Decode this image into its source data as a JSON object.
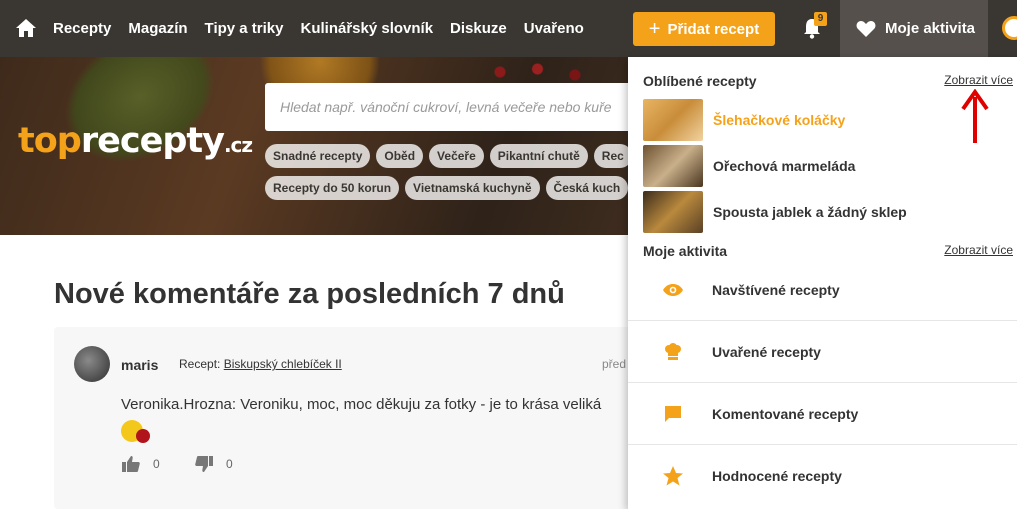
{
  "nav": {
    "links": [
      "Recepty",
      "Magazín",
      "Tipy a triky",
      "Kulinářský slovník",
      "Diskuze",
      "Uvařeno"
    ],
    "add_button": "Přidat recept",
    "notification_count": "9",
    "activity_label": "Moje aktivita"
  },
  "hero": {
    "logo_top": "top",
    "logo_recepty": "recepty",
    "logo_cz": ".cz",
    "search_placeholder": "Hledat např. vánoční cukroví, levná večeře nebo kuře",
    "tags_row1": [
      "Snadné recepty",
      "Oběd",
      "Večeře",
      "Pikantní chutě",
      "Rec"
    ],
    "tags_row2": [
      "Recepty do 50 korun",
      "Vietnamská kuchyně",
      "Česká kuch"
    ]
  },
  "main": {
    "heading": "Nové komentáře za posledních 7 dnů",
    "comment": {
      "user": "maris",
      "recipe_prefix": "Recept: ",
      "recipe_link": "Biskupský chlebíček II",
      "date": "před",
      "text": "Veronika.Hrozna: Veroniku, moc, moc děkuju za fotky - je to krása veliká",
      "likes": "0",
      "dislikes": "0"
    }
  },
  "dropdown": {
    "favorites_title": "Oblíbené recepty",
    "show_more": "Zobrazit více",
    "favorites": [
      {
        "name": "Šlehačkové koláčky",
        "color": "#d9a24a"
      },
      {
        "name": "Ořechová marmeláda",
        "color": "#8a6a3f"
      },
      {
        "name": "Spousta jablek a žádný sklep",
        "color": "#6a5030"
      }
    ],
    "activity_title": "Moje aktivita",
    "activity_more": "Zobrazit více",
    "items": [
      {
        "label": "Navštívené recepty",
        "icon": "eye-icon"
      },
      {
        "label": "Uvařené recepty",
        "icon": "chef-hat-icon"
      },
      {
        "label": "Komentované recepty",
        "icon": "comment-icon"
      },
      {
        "label": "Hodnocené recepty",
        "icon": "star-icon"
      }
    ]
  },
  "colors": {
    "accent": "#f5a21b",
    "nav_bg": "#3a3632",
    "annotation_arrow": "#e00000"
  }
}
